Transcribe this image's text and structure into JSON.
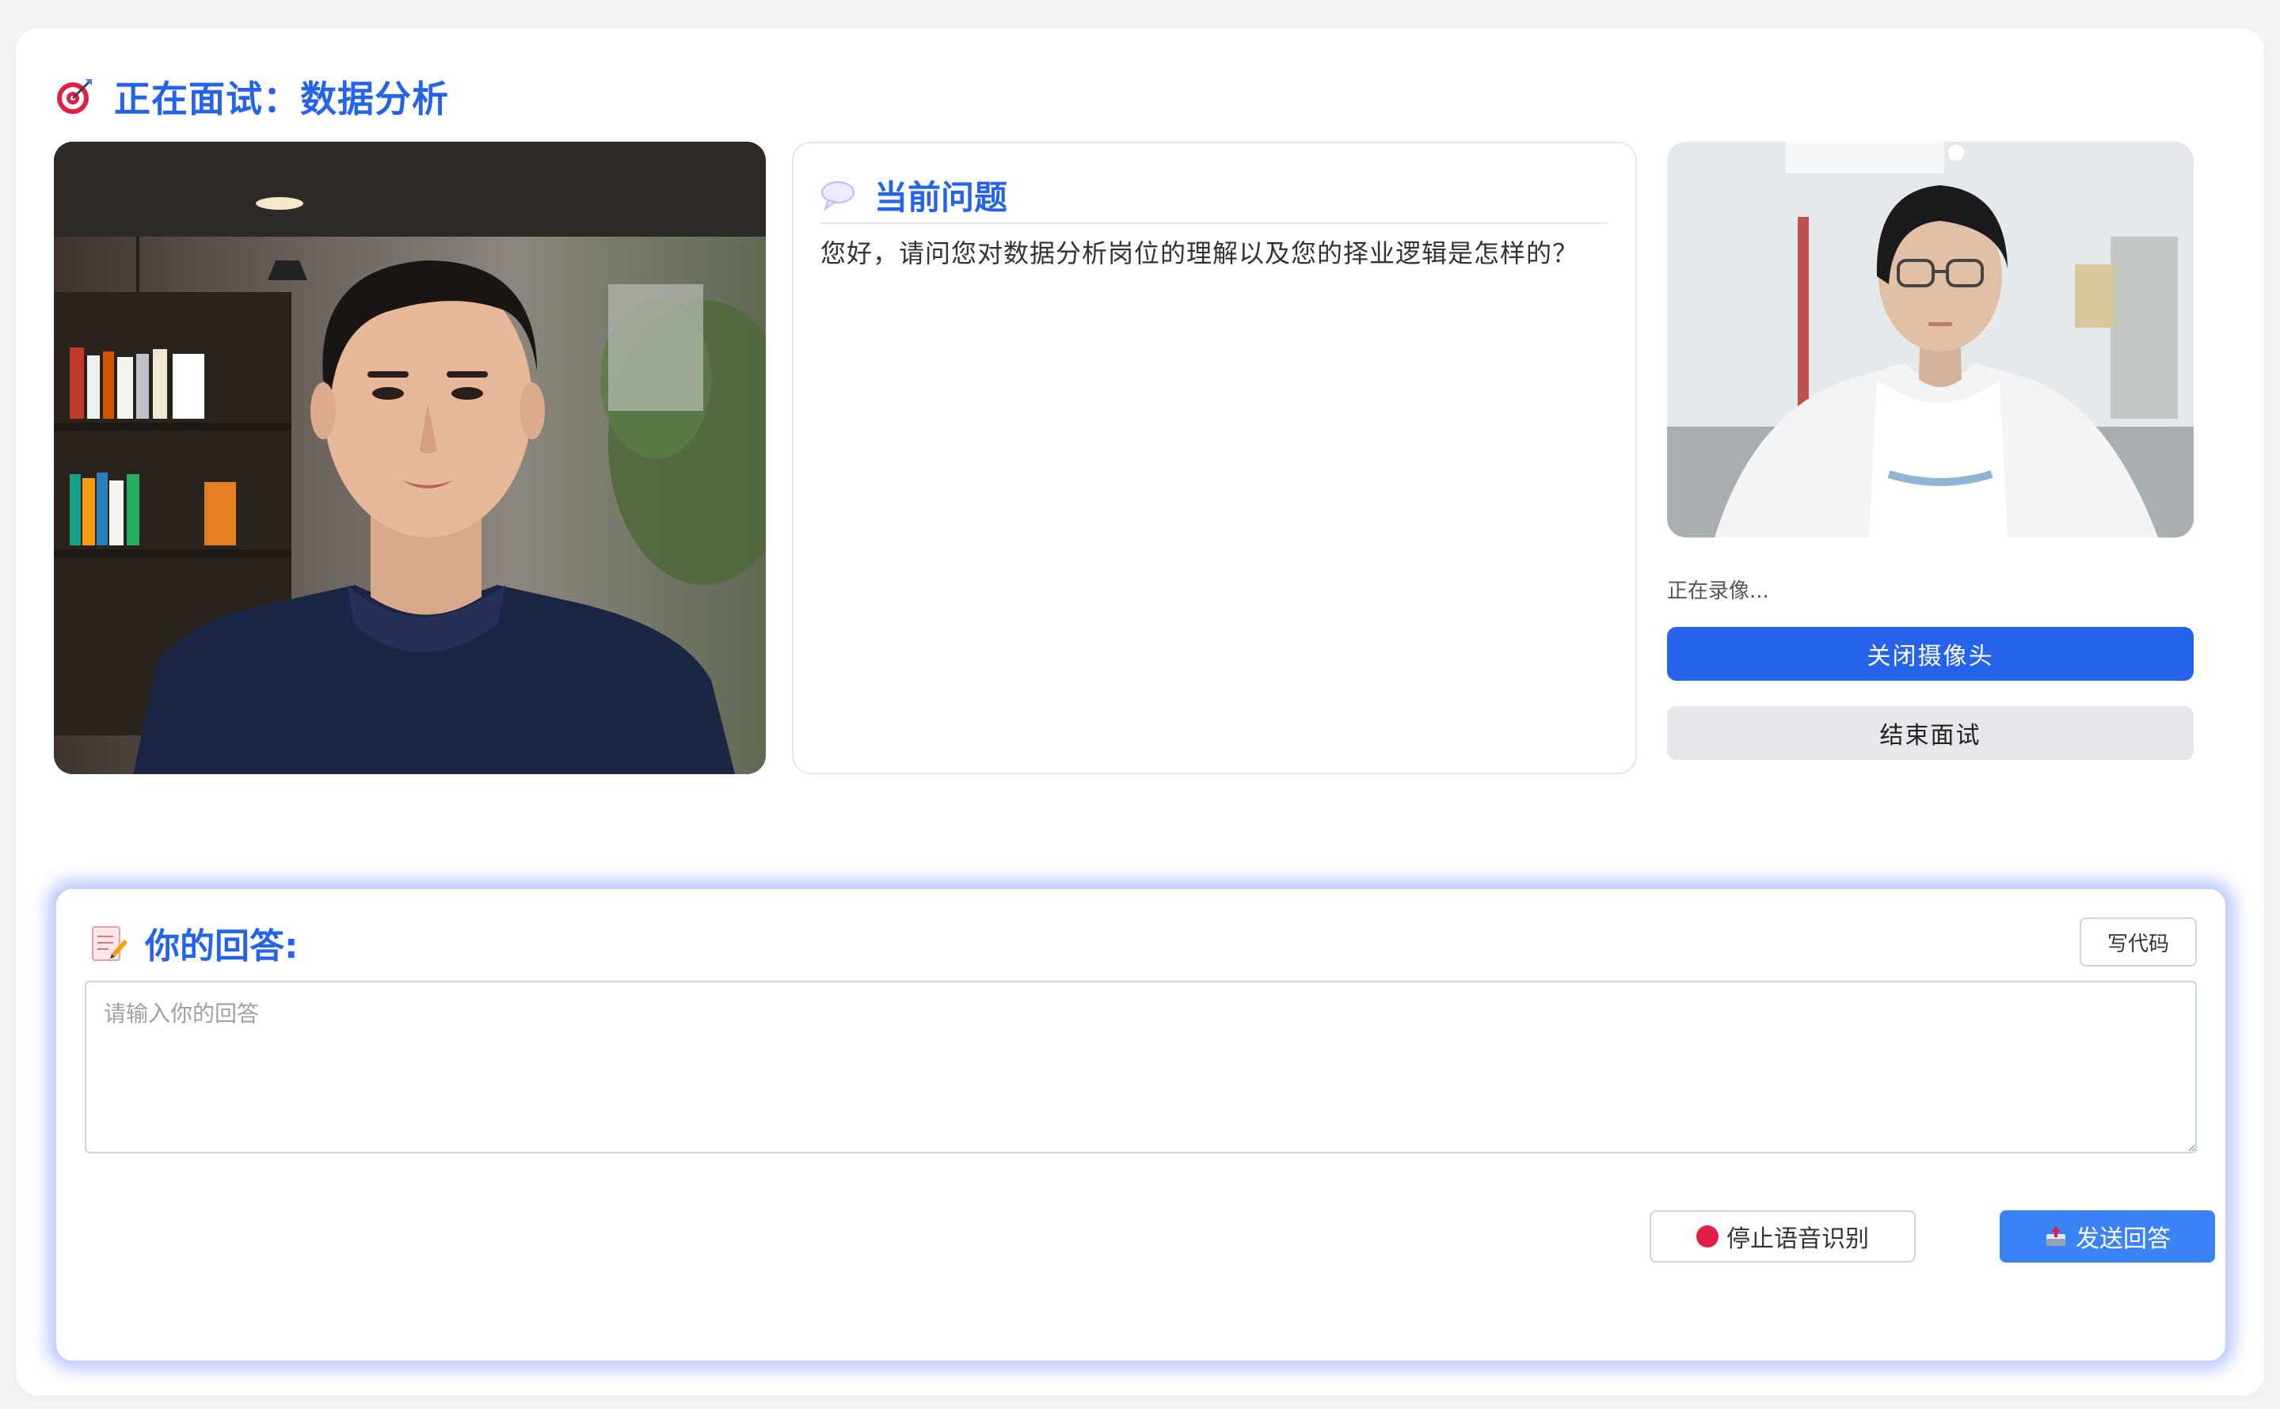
{
  "header": {
    "title": "正在面试：数据分析",
    "icon": "target-icon"
  },
  "question": {
    "title": "当前问题",
    "icon": "speech-bubble-icon",
    "text": "您好，请问您对数据分析岗位的理解以及您的择业逻辑是怎样的？"
  },
  "camera": {
    "status": "正在录像...",
    "close_label": "关闭摄像头",
    "end_label": "结束面试"
  },
  "answer": {
    "title": "你的回答:",
    "icon": "memo-icon",
    "code_label": "写代码",
    "placeholder": "请输入你的回答",
    "stop_label": "停止语音识别",
    "stop_icon": "stop-sign-icon",
    "send_label": "发送回答",
    "send_icon": "outbox-icon"
  },
  "colors": {
    "accent": "#2563eb",
    "send": "#3b82f6",
    "stop": "#e11d48"
  }
}
